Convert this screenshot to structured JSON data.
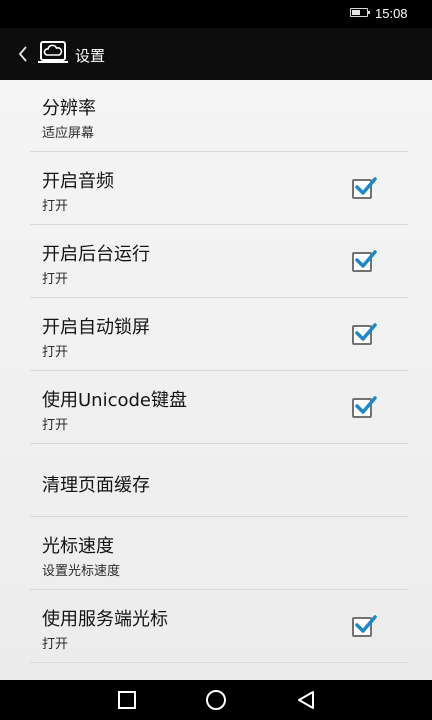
{
  "status_bar": {
    "time": "15:08",
    "battery_level": 0.55,
    "battery_icon": "battery-icon"
  },
  "action_bar": {
    "title": "设置",
    "back_icon": "chevron-left-icon",
    "app_icon": "cloud-app-icon"
  },
  "settings": [
    {
      "title": "分辨率",
      "subtitle": "适应屏幕",
      "has_checkbox": false,
      "checked": false
    },
    {
      "title": "开启音频",
      "subtitle": "打开",
      "has_checkbox": true,
      "checked": true
    },
    {
      "title": "开启后台运行",
      "subtitle": "打开",
      "has_checkbox": true,
      "checked": true
    },
    {
      "title": "开启自动锁屏",
      "subtitle": "打开",
      "has_checkbox": true,
      "checked": true
    },
    {
      "title": "使用Unicode键盘",
      "subtitle": "打开",
      "has_checkbox": true,
      "checked": true
    },
    {
      "title": "清理页面缓存",
      "subtitle": "",
      "has_checkbox": false,
      "checked": false
    },
    {
      "title": "光标速度",
      "subtitle": "设置光标速度",
      "has_checkbox": false,
      "checked": false
    },
    {
      "title": "使用服务端光标",
      "subtitle": "打开",
      "has_checkbox": true,
      "checked": true
    }
  ],
  "colors": {
    "check_accent": "#1e88c8",
    "status_bar_bg": "#000000",
    "action_bar_bg": "#0d0d0d",
    "list_bg": "#f3f3f3"
  },
  "nav_bar": {
    "recents_icon": "square-icon",
    "home_icon": "circle-icon",
    "back_icon": "triangle-back-icon"
  }
}
